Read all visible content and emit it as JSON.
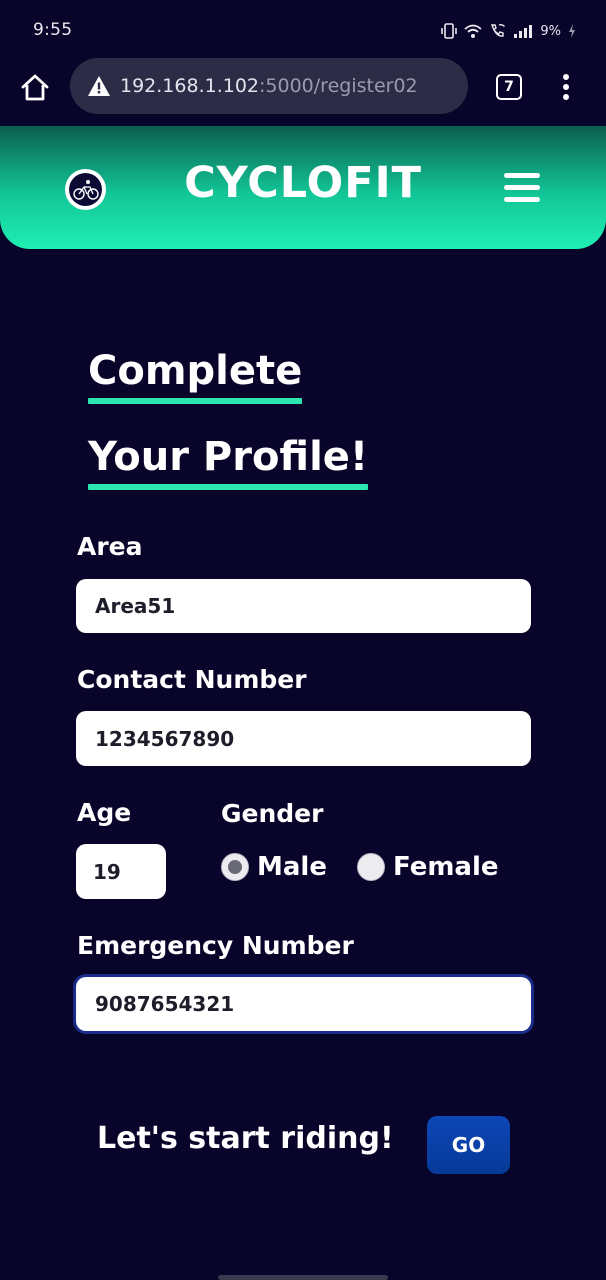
{
  "status_bar": {
    "time": "9:55",
    "battery": "9%",
    "icons": [
      "vibrate-icon",
      "wifi-icon",
      "wifi-call-icon",
      "signal-icon",
      "battery-charging-icon"
    ]
  },
  "browser": {
    "url_host": "192.168.1.102",
    "url_path": ":5000/register02",
    "tab_count": "7",
    "icons": [
      "home-icon",
      "warning-icon",
      "overflow-menu-icon"
    ]
  },
  "header": {
    "brand": "CYCLOFIT",
    "icons": [
      "cyclist-logo-icon",
      "hamburger-menu-icon"
    ]
  },
  "form": {
    "title_line1": "Complete",
    "title_line2": "Your Profile!",
    "area_label": "Area",
    "area_value": "Area51",
    "contact_label": "Contact Number",
    "contact_value": "1234567890",
    "age_label": "Age",
    "age_value": "19",
    "gender_label": "Gender",
    "gender_options": [
      {
        "label": "Male",
        "checked": true
      },
      {
        "label": "Female",
        "checked": false
      }
    ],
    "emergency_label": "Emergency Number",
    "emergency_value": "9087654321"
  },
  "footer": {
    "cta_text": "Let's start riding!",
    "go_label": "GO"
  },
  "colors": {
    "background": "#09052a",
    "accent": "#2ee6b0",
    "button": "#0b44b0",
    "header_gradient": [
      "#0b5f4f",
      "#1ff0b4"
    ]
  }
}
